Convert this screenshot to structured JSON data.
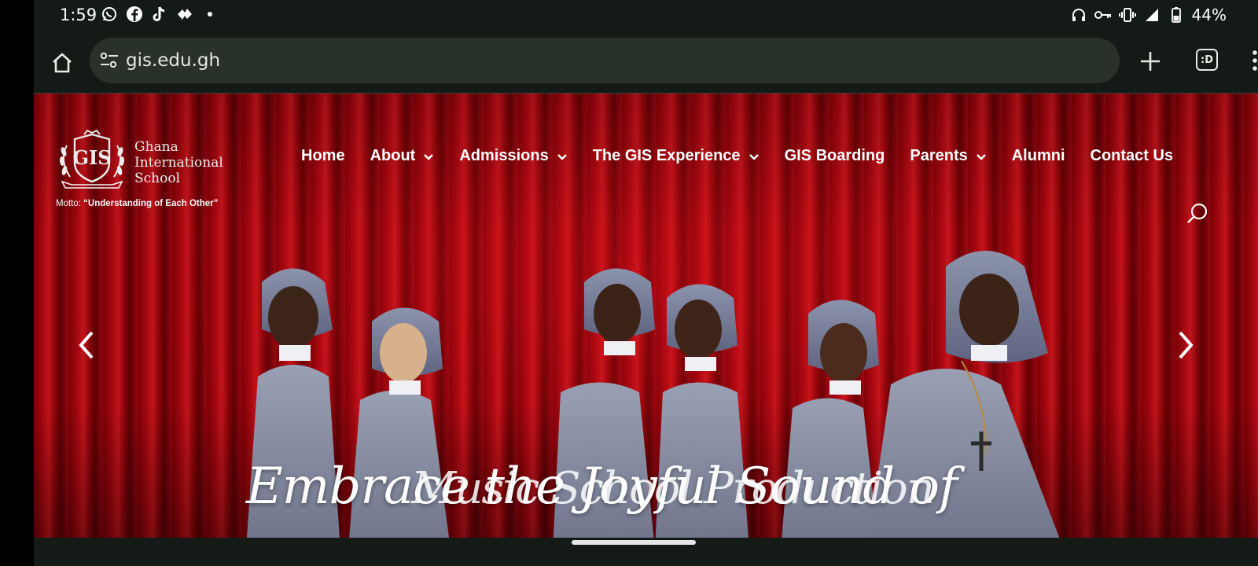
{
  "status_bar": {
    "time": "1:59",
    "left_icons": [
      "whatsapp-icon",
      "facebook-icon",
      "tiktok-icon",
      "app-icon",
      "dot-icon"
    ],
    "right_icons": [
      "headphones-icon",
      "key-icon",
      "vibrate-icon",
      "signal-icon",
      "battery-icon"
    ],
    "battery": "44%"
  },
  "browser": {
    "url": "gis.edu.gh",
    "tabs_label": ":D"
  },
  "site": {
    "logo_text": "GIS",
    "name_lines": [
      "Ghana",
      "International",
      "School"
    ],
    "motto_prefix": "Motto: ",
    "motto": "“Understanding of Each Other”",
    "nav": [
      {
        "label": "Home",
        "dropdown": false
      },
      {
        "label": "About",
        "dropdown": true
      },
      {
        "label": "Admissions",
        "dropdown": true
      },
      {
        "label": "The GIS Experience",
        "dropdown": true
      },
      {
        "label": "GIS Boarding",
        "dropdown": false
      },
      {
        "label": "Parents",
        "dropdown": true
      },
      {
        "label": "Alumni",
        "dropdown": false
      },
      {
        "label": "Contact Us",
        "dropdown": false
      }
    ],
    "hero_caption": "Embrace the Joyful Sound of",
    "hero_caption_overlap": "Music School Production"
  },
  "colors": {
    "accent": "#b30a12",
    "text": "#ffffff",
    "browser_bg": "#141a16",
    "urlbar_bg": "#283228"
  }
}
